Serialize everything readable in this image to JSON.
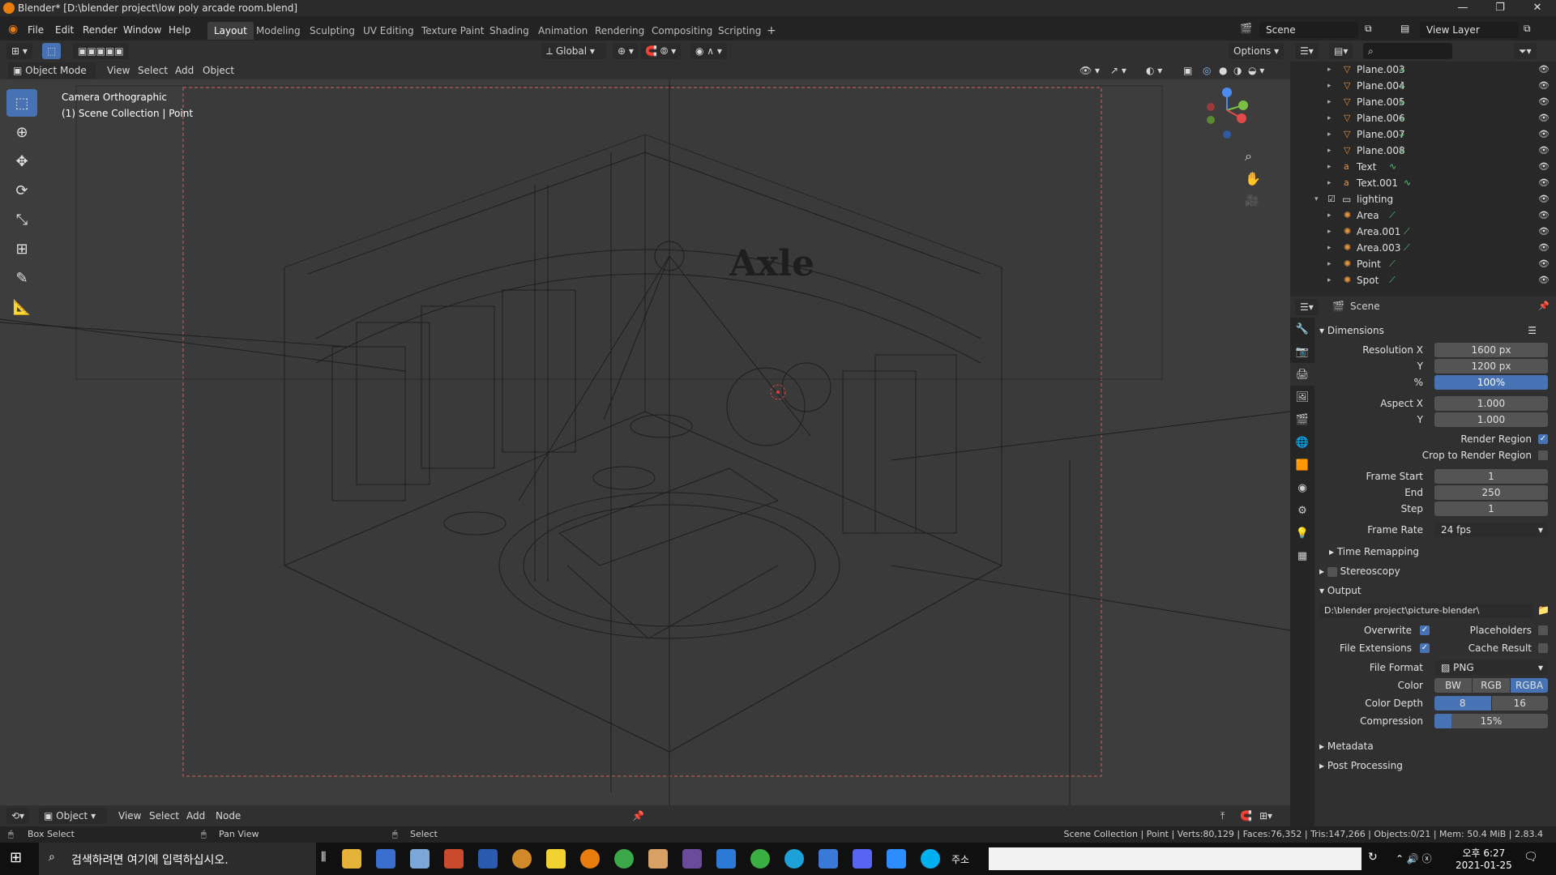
{
  "window": {
    "title": "Blender* [D:\\blender project\\low poly arcade room.blend]"
  },
  "menu": [
    "File",
    "Edit",
    "Render",
    "Window",
    "Help"
  ],
  "workspaces": [
    "Layout",
    "Modeling",
    "Sculpting",
    "UV Editing",
    "Texture Paint",
    "Shading",
    "Animation",
    "Rendering",
    "Compositing",
    "Scripting"
  ],
  "workspace_add": "+",
  "scene_name": "Scene",
  "view_layer": "View Layer",
  "toolhead": {
    "transform": "Global",
    "options": "Options"
  },
  "v3d": {
    "mode": "Object Mode",
    "menus": [
      "View",
      "Select",
      "Add",
      "Object"
    ]
  },
  "overlay": {
    "line1": "Camera Orthographic",
    "line2": "(1) Scene Collection | Point"
  },
  "scene_text": "Axle",
  "outliner": {
    "items": [
      {
        "name": "Plane.003",
        "type": "mesh"
      },
      {
        "name": "Plane.004",
        "type": "mesh"
      },
      {
        "name": "Plane.005",
        "type": "mesh"
      },
      {
        "name": "Plane.006",
        "type": "mesh"
      },
      {
        "name": "Plane.007",
        "type": "mesh"
      },
      {
        "name": "Plane.008",
        "type": "mesh"
      },
      {
        "name": "Text",
        "type": "text"
      },
      {
        "name": "Text.001",
        "type": "text"
      },
      {
        "name": "lighting",
        "type": "collection"
      },
      {
        "name": "Area",
        "type": "light"
      },
      {
        "name": "Area.001",
        "type": "light"
      },
      {
        "name": "Area.003",
        "type": "light"
      },
      {
        "name": "Point",
        "type": "light"
      },
      {
        "name": "Spot",
        "type": "light"
      }
    ]
  },
  "properties": {
    "context": "Scene",
    "dimensions": {
      "title": "Dimensions",
      "res_x_label": "Resolution X",
      "res_x": "1600 px",
      "y_label": "Y",
      "res_y": "1200 px",
      "pct_label": "%",
      "pct": "100%",
      "aspect_x_label": "Aspect X",
      "aspect_x": "1.000",
      "aspect_y": "1.000",
      "render_region": "Render Region",
      "crop": "Crop to Render Region",
      "frame_start_label": "Frame Start",
      "frame_start": "1",
      "end_label": "End",
      "end": "250",
      "step_label": "Step",
      "step": "1",
      "frame_rate_label": "Frame Rate",
      "frame_rate": "24 fps",
      "time_remap": "Time Remapping"
    },
    "stereoscopy": "Stereoscopy",
    "output": {
      "title": "Output",
      "path": "D:\\blender project\\picture-blender\\",
      "overwrite": "Overwrite",
      "placeholders": "Placeholders",
      "file_ext": "File Extensions",
      "cache": "Cache Result",
      "format_label": "File Format",
      "format": "PNG",
      "color_label": "Color",
      "color_opts": [
        "BW",
        "RGB",
        "RGBA"
      ],
      "depth_label": "Color Depth",
      "depth_opts": [
        "8",
        "16"
      ],
      "compression_label": "Compression",
      "compression": "15%",
      "compression_value": 0.15
    },
    "metadata": "Metadata",
    "post": "Post Processing"
  },
  "nodehead": {
    "mode": "Object",
    "menus": [
      "View",
      "Select",
      "Add",
      "Node"
    ]
  },
  "status": {
    "box": "Box Select",
    "pan": "Pan View",
    "select": "Select",
    "info": "Scene Collection | Point | Verts:80,129 | Faces:76,352 | Tris:147,266 | Objects:0/21 | Mem: 50.4 MiB | 2.83.4"
  },
  "taskbar": {
    "search": "검색하려면 여기에 입력하십시오.",
    "addr": "주소",
    "time": "오후 6:27",
    "date": "2021-01-25"
  }
}
